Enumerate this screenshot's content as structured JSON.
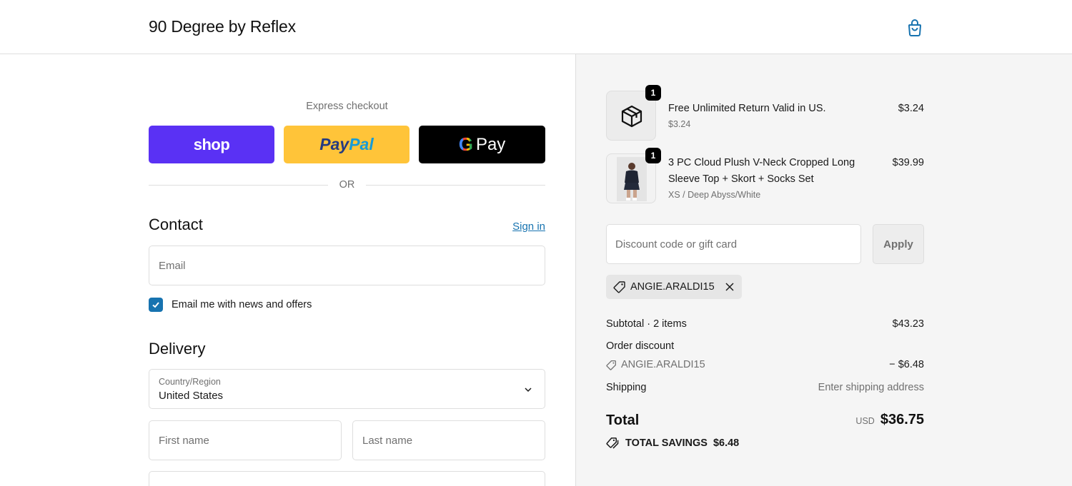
{
  "header": {
    "brand": "90 Degree by Reflex",
    "cart_icon": "shopping-bag-icon"
  },
  "express": {
    "label": "Express checkout",
    "shop_label": "shop",
    "paypal_label_1": "Pay",
    "paypal_label_2": "Pal",
    "gpay_g": "G",
    "gpay_label": "Pay",
    "or_label": "OR"
  },
  "contact": {
    "title": "Contact",
    "sign_in": "Sign in",
    "email_placeholder": "Email",
    "newsletter_label": "Email me with news and offers",
    "newsletter_checked": true
  },
  "delivery": {
    "title": "Delivery",
    "country_label": "Country/Region",
    "country_value": "United States",
    "first_name_placeholder": "First name",
    "last_name_placeholder": "Last name"
  },
  "cart": {
    "items": [
      {
        "name": "Free Unlimited Return Valid in US.",
        "sub": "$3.24",
        "price": "$3.24",
        "qty": "1",
        "thumb_icon": "package-icon"
      },
      {
        "name": "3 PC Cloud Plush V-Neck Cropped Long Sleeve Top + Skort + Socks Set",
        "sub": "XS / Deep Abyss/White",
        "price": "$39.99",
        "qty": "1",
        "thumb_icon": "product-photo"
      }
    ]
  },
  "discount": {
    "placeholder": "Discount code or gift card",
    "apply_label": "Apply",
    "applied_code": "ANGIE.ARALDI15"
  },
  "summary": {
    "subtotal_label": "Subtotal · 2 items",
    "subtotal_value": "$43.23",
    "order_discount_label": "Order discount",
    "discount_code": "ANGIE.ARALDI15",
    "discount_value": "− $6.48",
    "shipping_label": "Shipping",
    "shipping_value": "Enter shipping address",
    "total_label": "Total",
    "currency": "USD",
    "total_value": "$36.75",
    "savings_label": "TOTAL SAVINGS",
    "savings_value": "$6.48"
  },
  "colors": {
    "accent": "#1773b0",
    "shop": "#5a31f4",
    "paypal": "#ffc439",
    "gpay": "#000000"
  }
}
